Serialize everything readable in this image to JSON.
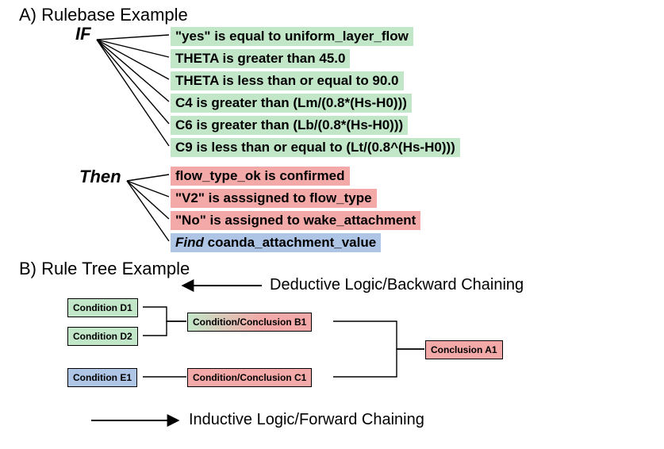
{
  "sections": {
    "a_title": "A) Rulebase Example",
    "b_title": "B) Rule Tree Example"
  },
  "keywords": {
    "if": "IF",
    "then": "Then"
  },
  "if_rules": [
    "\"yes\" is equal to uniform_layer_flow",
    "THETA is greater than 45.0",
    "THETA is less than or equal to 90.0",
    "C4 is greater than (Lm/(0.8*(Hs-H0)))",
    "C6 is greater than (Lb/(0.8*(Hs-H0)))",
    "C9 is less than or equal to (Lt/(0.8^(Hs-H0)))"
  ],
  "then_actions": [
    "flow_type_ok is confirmed",
    "\"V2\" is asssigned to flow_type",
    "\"No\" is assigned to wake_attachment"
  ],
  "then_find_prefix": "Find",
  "then_find_rest": " coanda_attachment_value",
  "tree": {
    "d1": "Condition D1",
    "d2": "Condition D2",
    "e1": "Condition E1",
    "b1": "Condition/Conclusion B1",
    "c1": "Condition/Conclusion C1",
    "a1": "Conclusion A1"
  },
  "labels": {
    "deductive": "Deductive Logic/Backward Chaining",
    "inductive": "Inductive Logic/Forward Chaining"
  }
}
